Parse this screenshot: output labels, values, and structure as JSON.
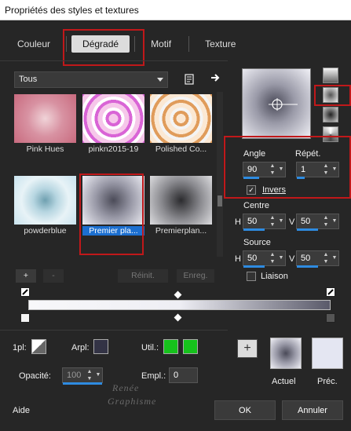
{
  "window": {
    "title": "Propriétés des styles et textures"
  },
  "tabs": [
    {
      "label": "Couleur"
    },
    {
      "label": "Dégradé"
    },
    {
      "label": "Motif"
    },
    {
      "label": "Texture"
    }
  ],
  "category": {
    "selected": "Tous"
  },
  "gallery": {
    "items": [
      {
        "caption": "Pink Hues",
        "colors": [
          "#c86a7e",
          "#f0d3d8"
        ]
      },
      {
        "caption": "pinkn2015-19",
        "colors": [
          "#d964d6",
          "#f6c7ea"
        ]
      },
      {
        "caption": "Polished Co...",
        "colors": [
          "#e09c5b",
          "#fbe8d3"
        ]
      },
      {
        "caption": "powderblue",
        "colors": [
          "#c9e3ee",
          "#6fa0b0"
        ]
      },
      {
        "caption": "Premier pla...",
        "colors": [
          "#4b4b58",
          "#eeeef5"
        ]
      },
      {
        "caption": "Premierplan...",
        "colors": [
          "#2b2b2e",
          "#dcdcdf"
        ]
      }
    ]
  },
  "buttons": {
    "add": "+",
    "remove": "-",
    "reset": "Réinit.",
    "save": "Enreg.",
    "ok": "OK",
    "cancel": "Annuler",
    "help": "Aide",
    "swap": "+"
  },
  "gradient": {
    "angle_label": "Angle",
    "angle": "90",
    "repeat_label": "Répét.",
    "repeat": "1",
    "invert_label": "Invers",
    "invert_checked": true,
    "center_label": "Centre",
    "center_h": "50",
    "center_v": "50",
    "source_label": "Source",
    "source_h": "50",
    "source_v": "50",
    "link_label": "Liaison",
    "link_checked": false,
    "h_label": "H",
    "v_label": "V"
  },
  "stops": {
    "location_label": "1pl:",
    "arpl_label": "Arpl:",
    "util_label": "Util.:",
    "opacity_label": "Opacité:",
    "opacity": "100",
    "empl_label": "Empl.:",
    "empl": "0",
    "util_color": "#16c21c"
  },
  "swatches": {
    "current_label": "Actuel",
    "previous_label": "Préc.",
    "previous_color": "#e4e6f2"
  },
  "watermark": {
    "line1": "Renée",
    "line2": "Graphisme"
  }
}
